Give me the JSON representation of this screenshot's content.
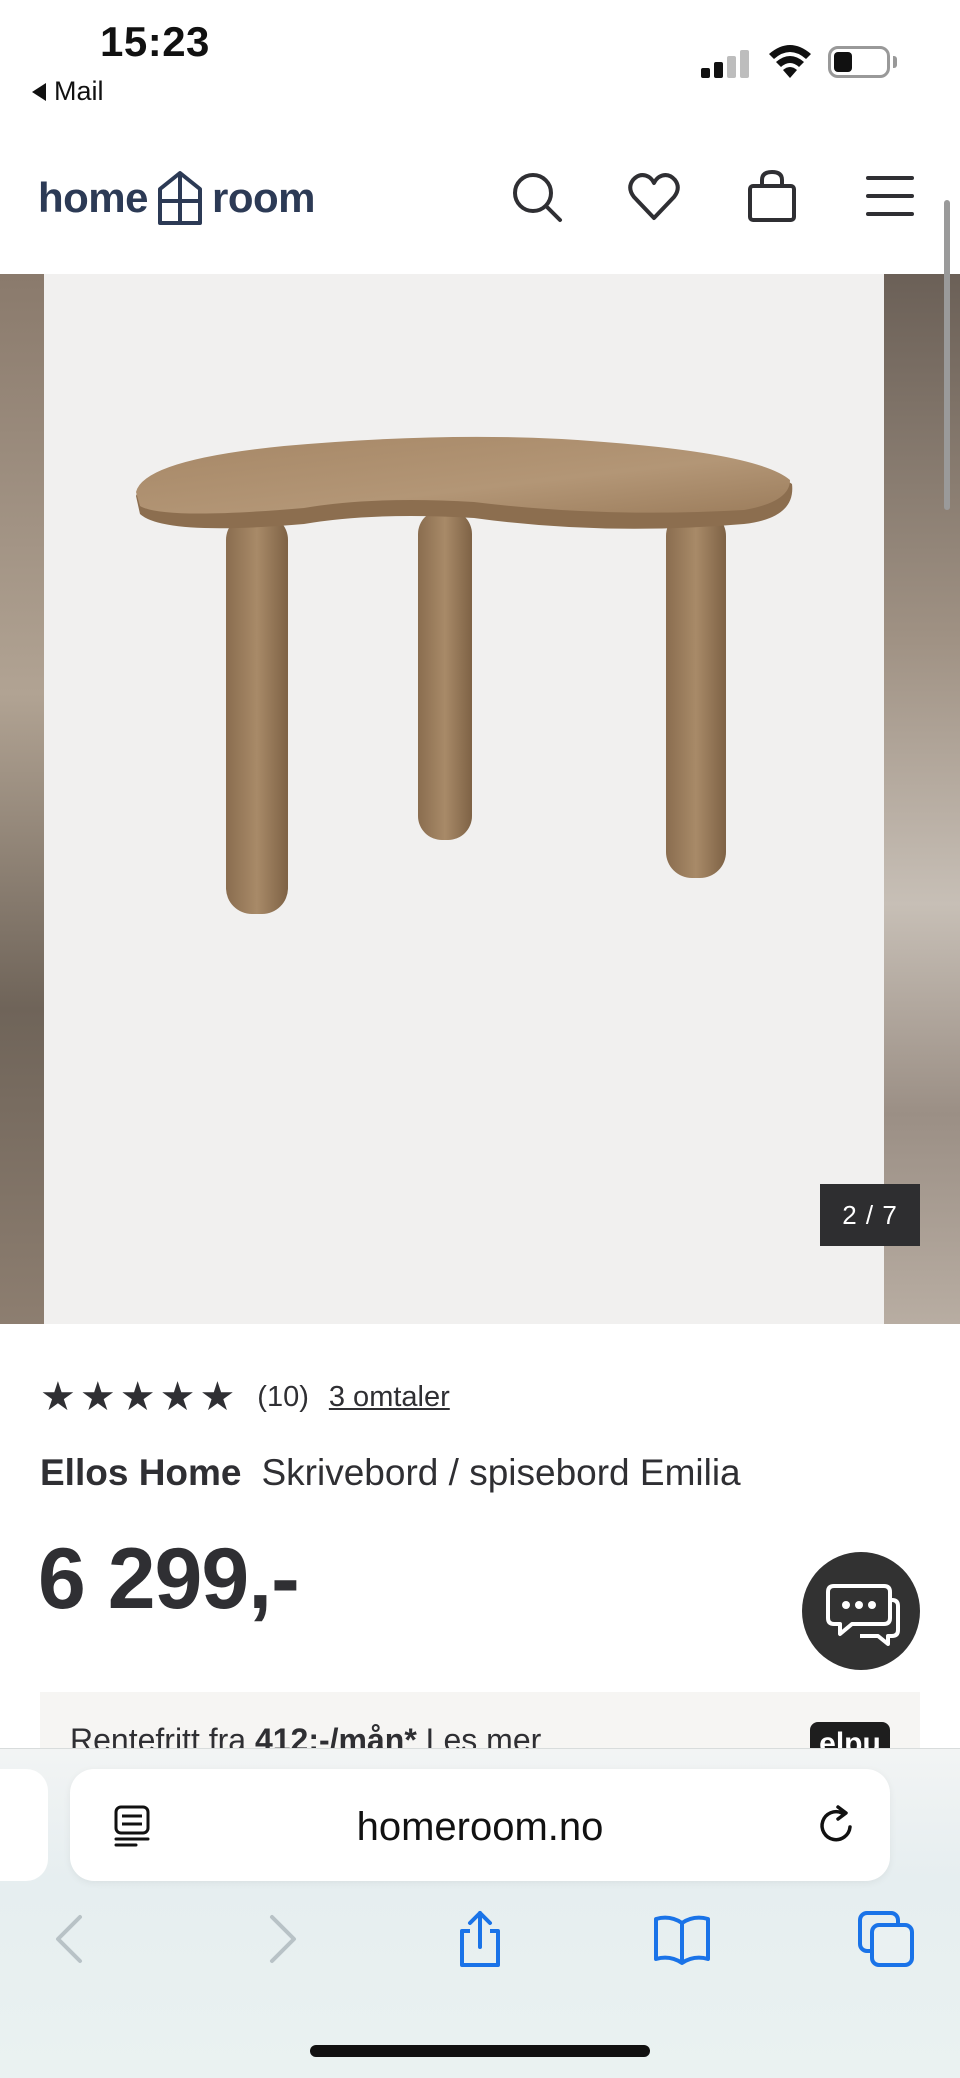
{
  "status_bar": {
    "time": "15:23",
    "back_app": "Mail",
    "battery_level": 0.35
  },
  "header": {
    "logo_left": "home",
    "logo_right": "room",
    "icons": [
      "search-icon",
      "heart-icon",
      "shopping-bag-icon",
      "menu-icon"
    ]
  },
  "gallery": {
    "counter": "2 / 7",
    "current_image": 2,
    "total_images": 7
  },
  "product": {
    "rating_stars": 5,
    "rating_count": "(10)",
    "reviews_link": "3 omtaler",
    "brand": "Ellos Home",
    "name": "Skrivebord / spisebord Emilia",
    "price": "6 299,-"
  },
  "finance": {
    "prefix": "Rentefritt fra",
    "amount": "412:-/mån*",
    "link": "Les mer",
    "badge": "elpu"
  },
  "browser": {
    "url": "homeroom.no"
  },
  "colors": {
    "text": "#2f2f33",
    "logo": "#2c3a55",
    "ios_blue": "#1a73e8"
  }
}
